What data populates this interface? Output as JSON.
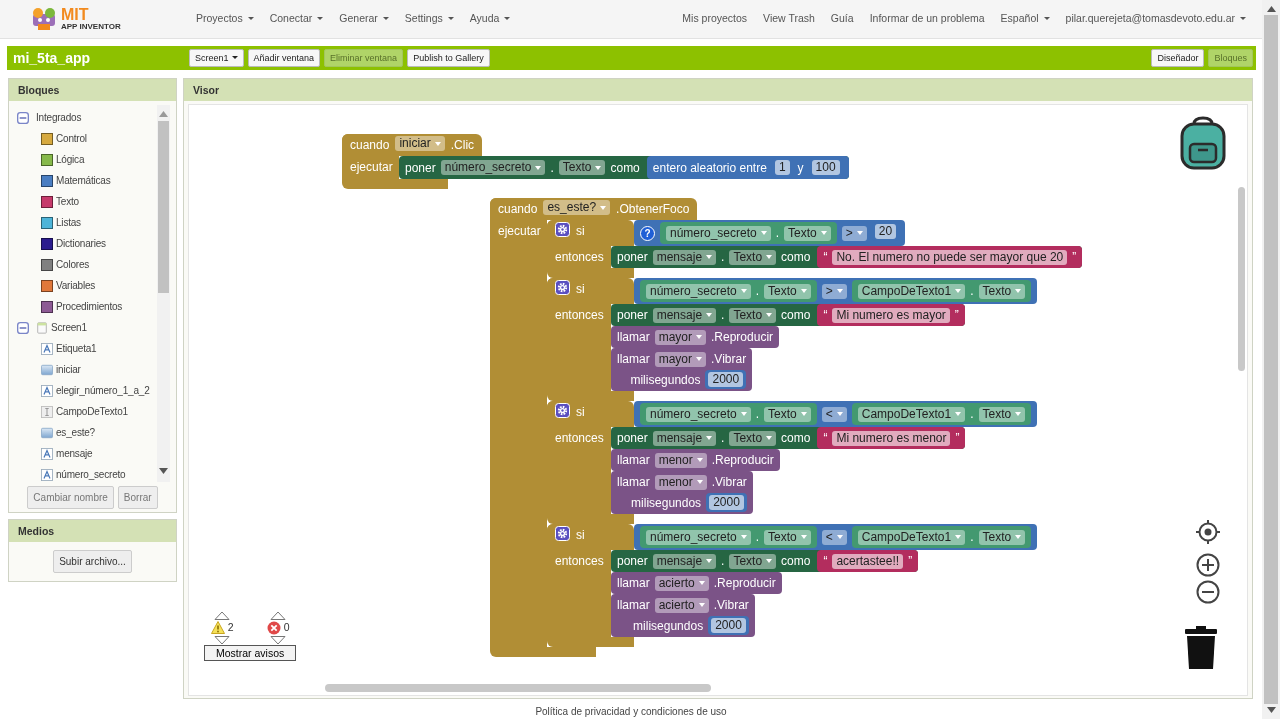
{
  "app": {
    "logo_title": "MIT",
    "logo_subtitle": "APP INVENTOR"
  },
  "menu": [
    {
      "label": "Proyectos",
      "dropdown": true
    },
    {
      "label": "Conectar",
      "dropdown": true
    },
    {
      "label": "Generar",
      "dropdown": true
    },
    {
      "label": "Settings",
      "dropdown": true
    },
    {
      "label": "Ayuda",
      "dropdown": true
    }
  ],
  "right_menu": [
    {
      "label": "Mis proyectos",
      "dropdown": false
    },
    {
      "label": "View Trash",
      "dropdown": false
    },
    {
      "label": "Guía",
      "dropdown": false
    },
    {
      "label": "Informar de un problema",
      "dropdown": false
    },
    {
      "label": "Español",
      "dropdown": true
    },
    {
      "label": "pilar.querejeta@tomasdevoto.edu.ar",
      "dropdown": true
    }
  ],
  "project_bar": {
    "title": "mi_5ta_app",
    "buttons": [
      {
        "label": "Screen1",
        "dropdown": true,
        "disabled": false
      },
      {
        "label": "Añadir ventana",
        "dropdown": false,
        "disabled": false
      },
      {
        "label": "Eliminar ventana",
        "dropdown": false,
        "disabled": true
      },
      {
        "label": "Publish to Gallery",
        "dropdown": false,
        "disabled": false
      }
    ],
    "views": [
      {
        "label": "Diseñador",
        "selected": false
      },
      {
        "label": "Bloques",
        "selected": true
      }
    ]
  },
  "blocks_panel": {
    "title": "Bloques",
    "tree": [
      {
        "label": "Integrados",
        "kind": "group",
        "expanded": true,
        "children": [
          {
            "label": "Control",
            "kind": "drawer",
            "color": "#d6a93e"
          },
          {
            "label": "Lógica",
            "kind": "drawer",
            "color": "#86b94a"
          },
          {
            "label": "Matemáticas",
            "kind": "drawer",
            "color": "#4a7ec2"
          },
          {
            "label": "Texto",
            "kind": "drawer",
            "color": "#c63a6b"
          },
          {
            "label": "Listas",
            "kind": "drawer",
            "color": "#4db4d8"
          },
          {
            "label": "Dictionaries",
            "kind": "drawer",
            "color": "#2b1c8e"
          },
          {
            "label": "Colores",
            "kind": "drawer",
            "color": "#808080"
          },
          {
            "label": "Variables",
            "kind": "drawer",
            "color": "#e0783b"
          },
          {
            "label": "Procedimientos",
            "kind": "drawer",
            "color": "#8d5a94"
          }
        ]
      },
      {
        "label": "Screen1",
        "kind": "screen",
        "expanded": true,
        "children": [
          {
            "label": "Etiqueta1",
            "kind": "label"
          },
          {
            "label": "iniciar",
            "kind": "button"
          },
          {
            "label": "elegir_número_1_a_2",
            "kind": "label"
          },
          {
            "label": "CampoDeTexto1",
            "kind": "textbox"
          },
          {
            "label": "es_este?",
            "kind": "button"
          },
          {
            "label": "mensaje",
            "kind": "label"
          },
          {
            "label": "número_secreto",
            "kind": "label"
          }
        ]
      }
    ],
    "buttons": [
      "Cambiar nombre",
      "Borrar"
    ]
  },
  "media_panel": {
    "title": "Medios",
    "buttons": [
      "Subir archivo..."
    ]
  },
  "viewer": {
    "title": "Visor",
    "blocks": [
      {
        "kind": "event",
        "header": [
          {
            "kind": "label",
            "text": "cuando"
          },
          {
            "kind": "dropdown",
            "text": "iniciar"
          },
          {
            "kind": "label",
            "text": ".Clic"
          }
        ],
        "arm_label": "ejecutar",
        "body": [
          {
            "kind": "setter",
            "parts": [
              {
                "kind": "label",
                "text": "poner"
              },
              {
                "kind": "dropdown",
                "text": "número_secreto"
              },
              {
                "kind": "label",
                "text": "."
              },
              {
                "kind": "dropdown",
                "text": "Texto"
              },
              {
                "kind": "label",
                "text": "como"
              },
              {
                "kind": "input",
                "block": {
                  "kind": "math",
                  "parts": [
                    {
                      "kind": "label",
                      "text": "entero aleatorio entre"
                    },
                    {
                      "kind": "input",
                      "block": {
                        "kind": "number",
                        "parts": [
                          {
                            "kind": "field",
                            "text": "1"
                          }
                        ]
                      }
                    },
                    {
                      "kind": "label",
                      "text": "y"
                    },
                    {
                      "kind": "input",
                      "block": {
                        "kind": "number",
                        "parts": [
                          {
                            "kind": "field",
                            "text": "100"
                          }
                        ]
                      }
                    }
                  ]
                }
              }
            ]
          }
        ]
      },
      {
        "kind": "event",
        "header": [
          {
            "kind": "label",
            "text": "cuando"
          },
          {
            "kind": "dropdown",
            "text": "es_este?"
          },
          {
            "kind": "label",
            "text": ".ObtenerFoco"
          }
        ],
        "arm_label": "ejecutar",
        "body": [
          {
            "kind": "if",
            "header": [
              {
                "kind": "mutator"
              },
              {
                "kind": "label",
                "text": "si"
              }
            ],
            "arm_label": "entonces",
            "condition": {
              "kind": "math",
              "parts": [
                {
                  "kind": "help",
                  "text": "?"
                },
                {
                  "kind": "input",
                  "block": {
                    "kind": "getter",
                    "parts": [
                      {
                        "kind": "dropdown",
                        "text": "número_secreto"
                      },
                      {
                        "kind": "label",
                        "text": "."
                      },
                      {
                        "kind": "dropdown",
                        "text": "Texto"
                      }
                    ]
                  }
                },
                {
                  "kind": "dropdown",
                  "text": ">"
                },
                {
                  "kind": "input",
                  "block": {
                    "kind": "number",
                    "parts": [
                      {
                        "kind": "field",
                        "text": "20"
                      }
                    ]
                  }
                }
              ]
            },
            "body": [
              {
                "kind": "setter",
                "parts": [
                  {
                    "kind": "label",
                    "text": "poner"
                  },
                  {
                    "kind": "dropdown",
                    "text": "mensaje"
                  },
                  {
                    "kind": "label",
                    "text": "."
                  },
                  {
                    "kind": "dropdown",
                    "text": "Texto"
                  },
                  {
                    "kind": "label",
                    "text": "como"
                  },
                  {
                    "kind": "input",
                    "block": {
                      "kind": "text",
                      "parts": [
                        {
                          "kind": "label",
                          "text": "“"
                        },
                        {
                          "kind": "field",
                          "text": "No. El numero no puede ser mayor que 20"
                        },
                        {
                          "kind": "label",
                          "text": "”"
                        }
                      ]
                    }
                  }
                ]
              }
            ]
          },
          {
            "kind": "if",
            "header": [
              {
                "kind": "mutator"
              },
              {
                "kind": "label",
                "text": "si"
              }
            ],
            "arm_label": "entonces",
            "condition": {
              "kind": "math",
              "parts": [
                {
                  "kind": "input",
                  "block": {
                    "kind": "getter",
                    "parts": [
                      {
                        "kind": "dropdown",
                        "text": "número_secreto"
                      },
                      {
                        "kind": "label",
                        "text": "."
                      },
                      {
                        "kind": "dropdown",
                        "text": "Texto"
                      }
                    ]
                  }
                },
                {
                  "kind": "dropdown",
                  "text": ">"
                },
                {
                  "kind": "input",
                  "block": {
                    "kind": "getter",
                    "parts": [
                      {
                        "kind": "dropdown",
                        "text": "CampoDeTexto1"
                      },
                      {
                        "kind": "label",
                        "text": "."
                      },
                      {
                        "kind": "dropdown",
                        "text": "Texto"
                      }
                    ]
                  }
                }
              ]
            },
            "body": [
              {
                "kind": "setter",
                "parts": [
                  {
                    "kind": "label",
                    "text": "poner"
                  },
                  {
                    "kind": "dropdown",
                    "text": "mensaje"
                  },
                  {
                    "kind": "label",
                    "text": "."
                  },
                  {
                    "kind": "dropdown",
                    "text": "Texto"
                  },
                  {
                    "kind": "label",
                    "text": "como"
                  },
                  {
                    "kind": "input",
                    "block": {
                      "kind": "text",
                      "parts": [
                        {
                          "kind": "label",
                          "text": "“"
                        },
                        {
                          "kind": "field",
                          "text": "Mi numero es mayor"
                        },
                        {
                          "kind": "label",
                          "text": "”"
                        }
                      ]
                    }
                  }
                ]
              },
              {
                "kind": "call",
                "parts": [
                  {
                    "kind": "label",
                    "text": "llamar"
                  },
                  {
                    "kind": "dropdown",
                    "text": "mayor"
                  },
                  {
                    "kind": "label",
                    "text": ".Reproducir"
                  }
                ]
              },
              {
                "kind": "call",
                "parts": [
                  {
                    "kind": "label",
                    "text": "llamar"
                  },
                  {
                    "kind": "dropdown",
                    "text": "mayor"
                  },
                  {
                    "kind": "label",
                    "text": ".Vibrar"
                  }
                ],
                "args": [
                  {
                    "label": "milisegundos",
                    "block": {
                      "kind": "number",
                      "parts": [
                        {
                          "kind": "field",
                          "text": "2000"
                        }
                      ]
                    }
                  }
                ]
              }
            ]
          },
          {
            "kind": "if",
            "header": [
              {
                "kind": "mutator"
              },
              {
                "kind": "label",
                "text": "si"
              }
            ],
            "arm_label": "entonces",
            "condition": {
              "kind": "math",
              "parts": [
                {
                  "kind": "input",
                  "block": {
                    "kind": "getter",
                    "parts": [
                      {
                        "kind": "dropdown",
                        "text": "número_secreto"
                      },
                      {
                        "kind": "label",
                        "text": "."
                      },
                      {
                        "kind": "dropdown",
                        "text": "Texto"
                      }
                    ]
                  }
                },
                {
                  "kind": "dropdown",
                  "text": "<"
                },
                {
                  "kind": "input",
                  "block": {
                    "kind": "getter",
                    "parts": [
                      {
                        "kind": "dropdown",
                        "text": "CampoDeTexto1"
                      },
                      {
                        "kind": "label",
                        "text": "."
                      },
                      {
                        "kind": "dropdown",
                        "text": "Texto"
                      }
                    ]
                  }
                }
              ]
            },
            "body": [
              {
                "kind": "setter",
                "parts": [
                  {
                    "kind": "label",
                    "text": "poner"
                  },
                  {
                    "kind": "dropdown",
                    "text": "mensaje"
                  },
                  {
                    "kind": "label",
                    "text": "."
                  },
                  {
                    "kind": "dropdown",
                    "text": "Texto"
                  },
                  {
                    "kind": "label",
                    "text": "como"
                  },
                  {
                    "kind": "input",
                    "block": {
                      "kind": "text",
                      "parts": [
                        {
                          "kind": "label",
                          "text": "“"
                        },
                        {
                          "kind": "field",
                          "text": "Mi numero es menor"
                        },
                        {
                          "kind": "label",
                          "text": "”"
                        }
                      ]
                    }
                  }
                ]
              },
              {
                "kind": "call",
                "parts": [
                  {
                    "kind": "label",
                    "text": "llamar"
                  },
                  {
                    "kind": "dropdown",
                    "text": "menor"
                  },
                  {
                    "kind": "label",
                    "text": ".Reproducir"
                  }
                ]
              },
              {
                "kind": "call",
                "parts": [
                  {
                    "kind": "label",
                    "text": "llamar"
                  },
                  {
                    "kind": "dropdown",
                    "text": "menor"
                  },
                  {
                    "kind": "label",
                    "text": ".Vibrar"
                  }
                ],
                "args": [
                  {
                    "label": "milisegundos",
                    "block": {
                      "kind": "number",
                      "parts": [
                        {
                          "kind": "field",
                          "text": "2000"
                        }
                      ]
                    }
                  }
                ]
              }
            ]
          },
          {
            "kind": "if",
            "header": [
              {
                "kind": "mutator"
              },
              {
                "kind": "label",
                "text": "si"
              }
            ],
            "arm_label": "entonces",
            "condition": {
              "kind": "math",
              "parts": [
                {
                  "kind": "input",
                  "block": {
                    "kind": "getter",
                    "parts": [
                      {
                        "kind": "dropdown",
                        "text": "número_secreto"
                      },
                      {
                        "kind": "label",
                        "text": "."
                      },
                      {
                        "kind": "dropdown",
                        "text": "Texto"
                      }
                    ]
                  }
                },
                {
                  "kind": "dropdown",
                  "text": "<"
                },
                {
                  "kind": "input",
                  "block": {
                    "kind": "getter",
                    "parts": [
                      {
                        "kind": "dropdown",
                        "text": "CampoDeTexto1"
                      },
                      {
                        "kind": "label",
                        "text": "."
                      },
                      {
                        "kind": "dropdown",
                        "text": "Texto"
                      }
                    ]
                  }
                }
              ]
            },
            "body": [
              {
                "kind": "setter",
                "parts": [
                  {
                    "kind": "label",
                    "text": "poner"
                  },
                  {
                    "kind": "dropdown",
                    "text": "mensaje"
                  },
                  {
                    "kind": "label",
                    "text": "."
                  },
                  {
                    "kind": "dropdown",
                    "text": "Texto"
                  },
                  {
                    "kind": "label",
                    "text": "como"
                  },
                  {
                    "kind": "input",
                    "block": {
                      "kind": "text",
                      "parts": [
                        {
                          "kind": "label",
                          "text": "“"
                        },
                        {
                          "kind": "field",
                          "text": "acertastee!!"
                        },
                        {
                          "kind": "label",
                          "text": "”"
                        }
                      ]
                    }
                  }
                ]
              },
              {
                "kind": "call",
                "parts": [
                  {
                    "kind": "label",
                    "text": "llamar"
                  },
                  {
                    "kind": "dropdown",
                    "text": "acierto"
                  },
                  {
                    "kind": "label",
                    "text": ".Reproducir"
                  }
                ]
              },
              {
                "kind": "call",
                "parts": [
                  {
                    "kind": "label",
                    "text": "llamar"
                  },
                  {
                    "kind": "dropdown",
                    "text": "acierto"
                  },
                  {
                    "kind": "label",
                    "text": ".Vibrar"
                  }
                ],
                "args": [
                  {
                    "label": "milisegundos",
                    "block": {
                      "kind": "number",
                      "parts": [
                        {
                          "kind": "field",
                          "text": "2000"
                        }
                      ]
                    }
                  }
                ]
              }
            ]
          }
        ]
      }
    ],
    "warnings": {
      "warning_count": "2",
      "error_count": "0",
      "button": "Mostrar avisos"
    }
  },
  "footer": {
    "text": "Política de privacidad y condiciones de uso"
  }
}
